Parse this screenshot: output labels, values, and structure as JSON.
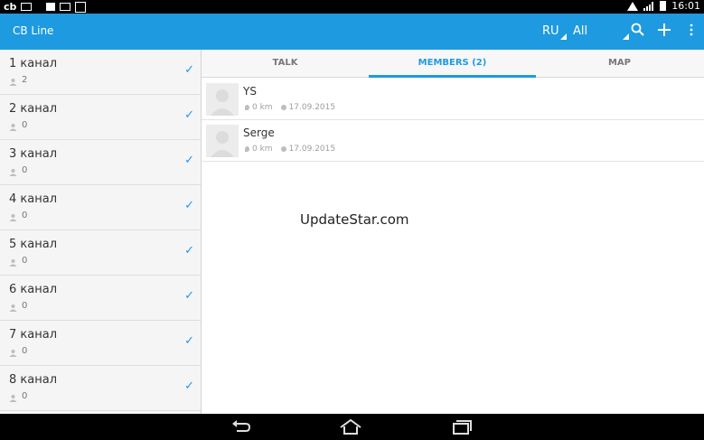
{
  "status_bar": {
    "left_icons": [
      "cb-icon",
      "mail-icon",
      "image-icon",
      "mail-icon",
      "checkbox-icon"
    ],
    "cb_text": "cb",
    "time": "16:01"
  },
  "action_bar": {
    "title": "CB Line",
    "language": "RU",
    "filter": "All"
  },
  "channels": [
    {
      "name": "1 канал",
      "count": "2"
    },
    {
      "name": "2 канал",
      "count": "0"
    },
    {
      "name": "3 канал",
      "count": "0"
    },
    {
      "name": "4 канал",
      "count": "0"
    },
    {
      "name": "5 канал",
      "count": "0"
    },
    {
      "name": "6 канал",
      "count": "0"
    },
    {
      "name": "7 канал",
      "count": "0"
    },
    {
      "name": "8 канал",
      "count": "0"
    }
  ],
  "tabs": [
    {
      "label": "TALK"
    },
    {
      "label": "MEMBERS (2)"
    },
    {
      "label": "MAP"
    }
  ],
  "members": [
    {
      "name": "YS",
      "distance": "0 km",
      "date": "17.09.2015"
    },
    {
      "name": "Serge",
      "distance": "0 km",
      "date": "17.09.2015"
    }
  ],
  "watermark": "UpdateStar.com",
  "colors": {
    "accent": "#1e9ae0",
    "check": "#2196f3"
  }
}
